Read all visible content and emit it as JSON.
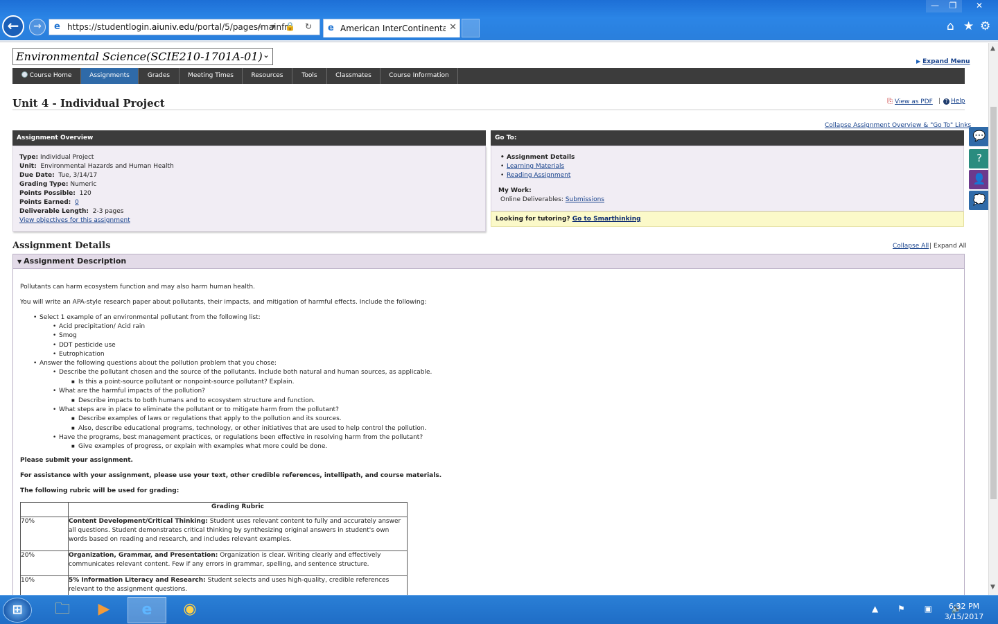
{
  "browser": {
    "url_prefix": "https://studentlogin.",
    "url_domain": "aiuniv.edu",
    "url_rest": "/portal/5/pages/mainfra",
    "tab_title": "American InterContinental ...",
    "tab_close": "✕",
    "addr_tools": "⌕ ▾ 🔒 ↻",
    "win_min": "—",
    "win_max": "❐",
    "win_close": "✕",
    "back_glyph": "←",
    "fwd_glyph": "→",
    "ie_glyph": "e",
    "home_glyph": "⌂",
    "star_glyph": "★",
    "gear_glyph": "⚙"
  },
  "course": {
    "select_value": "Environmental Science(SCIE210-1701A-01)",
    "chev": "⌄",
    "expand_menu": "Expand Menu"
  },
  "nav": {
    "items": [
      "Course Home",
      "Assignments",
      "Grades",
      "Meeting Times",
      "Resources",
      "Tools",
      "Classmates",
      "Course Information"
    ]
  },
  "header": {
    "title": "Unit 4 - Individual Project",
    "pdf_icon": "⎘",
    "view_pdf": "View as PDF",
    "sep": "|",
    "help_q": "?",
    "help": "Help",
    "collapse_overview": "Collapse Assignment Overview & \"Go To\" Links"
  },
  "overview": {
    "heading": "Assignment Overview",
    "type_label": "Type:",
    "type_value": "Individual Project",
    "unit_label": "Unit:",
    "unit_value": "Environmental Hazards and Human Health",
    "due_label": "Due Date:",
    "due_value": "Tue, 3/14/17",
    "grading_label": "Grading Type:",
    "grading_value": "Numeric",
    "points_label": "Points Possible:",
    "points_value": "120",
    "earned_label": "Points Earned:",
    "earned_value": "0",
    "length_label": "Deliverable Length:",
    "length_value": "2-3 pages",
    "objectives_link": "View objectives for this assignment"
  },
  "goto": {
    "heading": "Go To:",
    "details": "Assignment Details",
    "learning": "Learning Materials",
    "reading": "Reading Assignment",
    "my_work": "My Work:",
    "online_label": "Online Deliverables:",
    "submissions": "Submissions",
    "tutor_text": "Looking for tutoring?",
    "tutor_link": "Go to Smarthinking"
  },
  "details": {
    "title": "Assignment Details",
    "collapse_all": "Collapse All",
    "sep": "|",
    "expand_all": "Expand All",
    "desc_heading": "Assignment Description",
    "tri": "▼",
    "p1": "Pollutants can harm ecosystem function and may also harm human health.",
    "p2": "You will write an APA-style research paper about pollutants, their impacts, and mitigation of harmful effects. Include the following:",
    "b1": "Select 1 example of an environmental pollutant from the following list:",
    "b1a": "Acid precipitation/ Acid rain",
    "b1b": "Smog",
    "b1c": "DDT pesticide use",
    "b1d": "Eutrophication",
    "b2": "Answer the following questions about the pollution problem that you chose:",
    "q1": "Describe the pollutant chosen and the source of the pollutants. Include both natural and human sources, as applicable.",
    "q1a": "Is this a point-source pollutant or nonpoint-source pollutant? Explain.",
    "q2": "What are the harmful impacts of the pollution?",
    "q2a": "Describe impacts to both humans and to ecosystem structure and function.",
    "q3": "What steps are in place to eliminate the pollutant or to mitigate harm from the pollutant?",
    "q3a": "Describe examples of laws or regulations that apply to the pollution and its sources.",
    "q3b": "Also, describe educational programs, technology, or other initiatives that are used to help control the pollution.",
    "q4": "Have the programs, best management practices, or regulations been effective in resolving harm from the pollutant?",
    "q4a": "Give examples of progress, or explain with examples what more could be done.",
    "submit": "Please submit your assignment.",
    "assist": "For assistance with your assignment, please use your text, other credible references, intellipath, and course materials.",
    "rubric_intro": "The following rubric will be used for grading:"
  },
  "rubric": {
    "heading": "Grading Rubric",
    "rows": [
      {
        "pct": "70%",
        "title": "Content Development/Critical Thinking:",
        "text": "Student uses relevant content to fully and accurately answer all questions. Student demonstrates critical thinking by synthesizing original answers in student's own words based on reading and research, and includes relevant examples."
      },
      {
        "pct": "20%",
        "title": "Organization, Grammar, and Presentation:",
        "text": "Organization is clear. Writing clearly and effectively communicates relevant content. Few if any errors in grammar, spelling, and sentence structure."
      },
      {
        "pct": "10%",
        "title": "5% Information Literacy and Research:",
        "text": "Student selects and uses high-quality, credible references relevant to the assignment questions."
      }
    ]
  },
  "scroll": {
    "up": "▲",
    "down": "▼"
  },
  "side_widgets": {
    "chat": "💬",
    "help": "?",
    "contact": "👤",
    "ask": "💭"
  },
  "taskbar": {
    "start": "⊞",
    "explorer": "🗀",
    "media": "▶",
    "ie": "e",
    "chrome": "◉",
    "tray": "▲ ⚑ ▣ 🔊",
    "time": "6:32 PM",
    "date": "3/15/2017"
  }
}
